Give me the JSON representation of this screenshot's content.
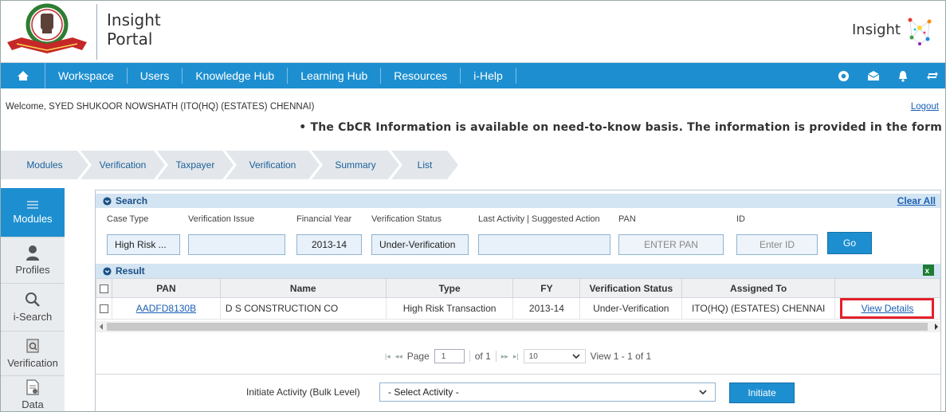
{
  "header": {
    "portal_title_line1": "Insight",
    "portal_title_line2": "Portal",
    "brand_name": "Insight"
  },
  "nav": {
    "items": [
      {
        "label": "Workspace"
      },
      {
        "label": "Users"
      },
      {
        "label": "Knowledge Hub"
      },
      {
        "label": "Learning Hub"
      },
      {
        "label": "Resources"
      },
      {
        "label": "i-Help"
      }
    ],
    "icons": [
      "home-icon",
      "settings-icon",
      "mail-icon",
      "bell-icon",
      "switch-icon"
    ]
  },
  "welcome": {
    "text": "Welcome, SYED SHUKOOR NOWSHATH (ITO(HQ) (ESTATES) CHENNAI)",
    "logout": "Logout"
  },
  "ticker": "• The CbCR Information is available on need-to-know basis. The information is provided in the form",
  "breadcrumb": [
    "Modules",
    "Verification",
    "Taxpayer",
    "Verification",
    "Summary",
    "List"
  ],
  "sidebar": {
    "items": [
      {
        "label": "Modules",
        "icon": "menu-icon"
      },
      {
        "label": "Profiles",
        "icon": "user-icon"
      },
      {
        "label": "i-Search",
        "icon": "search-icon"
      },
      {
        "label": "Verification",
        "icon": "verification-icon"
      },
      {
        "label": "Data",
        "icon": "data-icon"
      }
    ]
  },
  "search": {
    "title": "Search",
    "clear_all": "Clear All",
    "fields": {
      "case_type": {
        "label": "Case Type",
        "value": "High Risk ..."
      },
      "verification_issue": {
        "label": "Verification Issue",
        "value": ""
      },
      "financial_year": {
        "label": "Financial Year",
        "value": "2013-14"
      },
      "verification_status": {
        "label": "Verification Status",
        "value": "Under-Verification"
      },
      "last_activity": {
        "label": "Last Activity | Suggested Action",
        "value": ""
      },
      "pan": {
        "label": "PAN",
        "placeholder": "ENTER PAN"
      },
      "id": {
        "label": "ID",
        "placeholder": "Enter ID"
      }
    },
    "go_label": "Go"
  },
  "result": {
    "title": "Result",
    "columns": [
      "PAN",
      "Name",
      "Type",
      "FY",
      "Verification Status",
      "Assigned To"
    ],
    "rows": [
      {
        "pan": "AADFD8130B",
        "name": "D S CONSTRUCTION CO",
        "type": "High Risk Transaction",
        "fy": "2013-14",
        "status": "Under-Verification",
        "assigned_to": "ITO(HQ) (ESTATES) CHENNAI",
        "action": "View Details"
      }
    ]
  },
  "pager": {
    "page_label": "Page",
    "page_value": "1",
    "of_label": "of 1",
    "rows_per_page": "10",
    "view_label": "View 1 - 1 of 1"
  },
  "bulk": {
    "label": "Initiate Activity (Bulk Level)",
    "select_value": "- Select Activity -",
    "initiate_label": "Initiate"
  },
  "colors": {
    "nav_blue": "#1d8fd0",
    "bar_blue": "#d3e4f2",
    "highlight_red": "#e2212a",
    "link_blue": "#1a5fb4"
  }
}
